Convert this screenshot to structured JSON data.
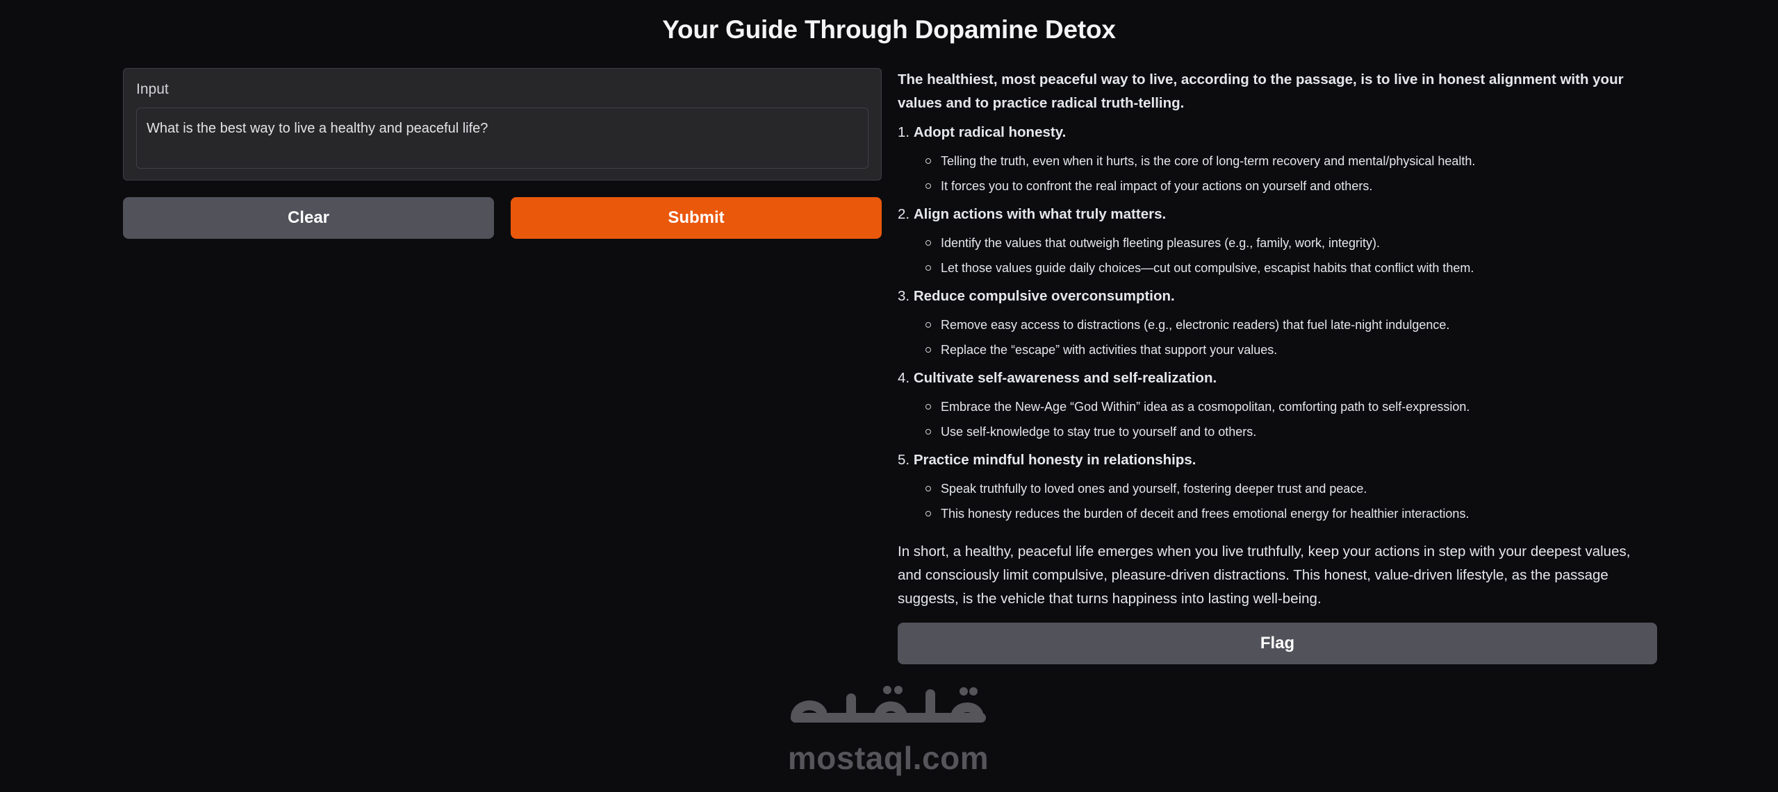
{
  "page": {
    "title": "Your Guide Through Dopamine Detox"
  },
  "input": {
    "label": "Input",
    "value": "What is the best way to live a healthy and peaceful life?"
  },
  "buttons": {
    "clear": "Clear",
    "submit": "Submit",
    "flag": "Flag"
  },
  "output": {
    "intro": "The healthiest, most peaceful way to live, according to the passage, is to live in honest alignment with your values and to practice radical truth-telling.",
    "steps": [
      {
        "num": "1.",
        "heading": "Adopt radical honesty.",
        "bullets": [
          "Telling the truth, even when it hurts, is the core of long-term recovery and mental/physical health.",
          "It forces you to confront the real impact of your actions on yourself and others."
        ]
      },
      {
        "num": "2.",
        "heading": "Align actions with what truly matters.",
        "bullets": [
          "Identify the values that outweigh fleeting pleasures (e.g., family, work, integrity).",
          "Let those values guide daily choices—cut out compulsive, escapist habits that conflict with them."
        ]
      },
      {
        "num": "3.",
        "heading": "Reduce compulsive overconsumption.",
        "bullets": [
          "Remove easy access to distractions (e.g., electronic readers) that fuel late-night indulgence.",
          "Replace the “escape” with activities that support your values."
        ]
      },
      {
        "num": "4.",
        "heading": "Cultivate self-awareness and self-realization.",
        "bullets": [
          "Embrace the New-Age “God Within” idea as a cosmopolitan, comforting path to self-expression.",
          "Use self-knowledge to stay true to yourself and to others."
        ]
      },
      {
        "num": "5.",
        "heading": "Practice mindful honesty in relationships.",
        "bullets": [
          "Speak truthfully to loved ones and yourself, fostering deeper trust and peace.",
          "This honesty reduces the burden of deceit and frees emotional energy for healthier interactions."
        ]
      }
    ],
    "summary": "In short, a healthy, peaceful life emerges when you live truthfully, keep your actions in step with your deepest values, and consciously limit compulsive, pleasure-driven distractions. This honest, value-driven lifestyle, as the passage suggests, is the vehicle that turns happiness into lasting well-being."
  },
  "watermark": {
    "arabic": "مستقل",
    "latin": "mostaql.com"
  },
  "colors": {
    "background": "#0c0c0f",
    "primary": "#ea580c",
    "secondary": "#52525b",
    "panel": "#27272a"
  }
}
